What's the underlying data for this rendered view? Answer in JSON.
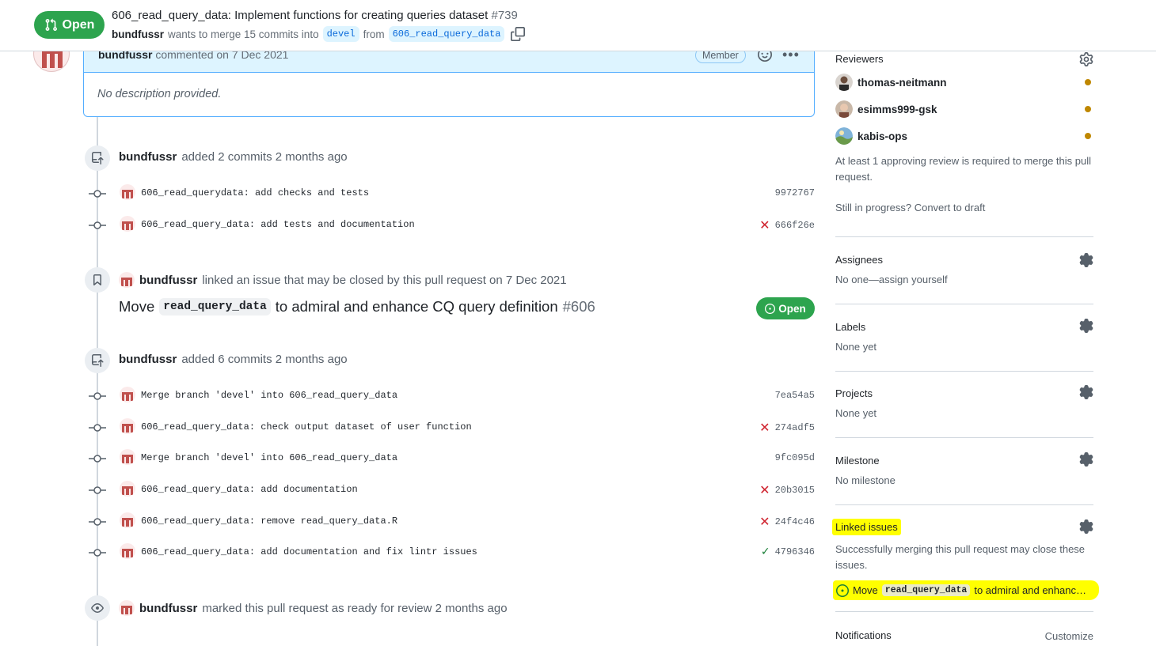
{
  "header": {
    "state": "Open",
    "title": "606_read_query_data: Implement functions for creating queries dataset",
    "number": "#739",
    "author": "bundfussr",
    "merge_text": "wants to merge 15 commits into",
    "base_branch": "devel",
    "from_text": "from",
    "head_branch": "606_read_query_data"
  },
  "comment": {
    "author": "bundfussr",
    "meta": "commented on 7 Dec 2021",
    "role": "Member",
    "body": "No description provided."
  },
  "events": {
    "added1": {
      "author": "bundfussr",
      "text": "added 2 commits 2 months ago"
    },
    "commits1": [
      {
        "message": "606_read_querydata: add checks and tests",
        "sha": "9972767",
        "status": "none"
      },
      {
        "message": "606_read_query_data: add tests and documentation",
        "sha": "666f26e",
        "status": "fail"
      }
    ],
    "linked": {
      "author": "bundfussr",
      "text": "linked an issue that may be closed by this pull request on 7 Dec 2021"
    },
    "issue": {
      "prefix": "Move",
      "code": "read_query_data",
      "suffix": "to admiral and enhance CQ query definition",
      "number": "#606",
      "state": "Open"
    },
    "added2": {
      "author": "bundfussr",
      "text": "added 6 commits 2 months ago"
    },
    "commits2": [
      {
        "message": "Merge branch 'devel' into 606_read_query_data",
        "sha": "7ea54a5",
        "status": "none"
      },
      {
        "message": "606_read_query_data: check output dataset of user function",
        "sha": "274adf5",
        "status": "fail"
      },
      {
        "message": "Merge branch 'devel' into 606_read_query_data",
        "sha": "9fc095d",
        "status": "none"
      },
      {
        "message": "606_read_query_data: add documentation",
        "sha": "20b3015",
        "status": "fail"
      },
      {
        "message": "606_read_query_data: remove read_query_data.R",
        "sha": "24f4c46",
        "status": "fail"
      },
      {
        "message": "606_read_query_data: add documentation and fix lintr issues",
        "sha": "4796346",
        "status": "success"
      }
    ],
    "ready": {
      "author": "bundfussr",
      "text": "marked this pull request as ready for review 2 months ago"
    }
  },
  "sidebar": {
    "reviewers_title": "Reviewers",
    "reviewers": [
      "thomas-neitmann",
      "esimms999-gsk",
      "kabis-ops"
    ],
    "review_note": "At least 1 approving review is required to merge this pull request.",
    "draft_note": "Still in progress? Convert to draft",
    "assignees_title": "Assignees",
    "assignees_value": "No one—assign yourself",
    "labels_title": "Labels",
    "labels_value": "None yet",
    "projects_title": "Projects",
    "projects_value": "None yet",
    "milestone_title": "Milestone",
    "milestone_value": "No milestone",
    "linked_title": "Linked issues",
    "linked_note": "Successfully merging this pull request may close these issues.",
    "linked_issue_prefix": "Move",
    "linked_issue_code": "read_query_data",
    "linked_issue_suffix": "to admiral and enhanc…",
    "notifications_title": "Notifications",
    "notifications_action": "Customize"
  },
  "colors": {
    "open_green": "#2da44e",
    "pending": "#bf8700",
    "fail": "#cf222e",
    "success": "#1a7f37",
    "highlight": "#ffff00"
  }
}
